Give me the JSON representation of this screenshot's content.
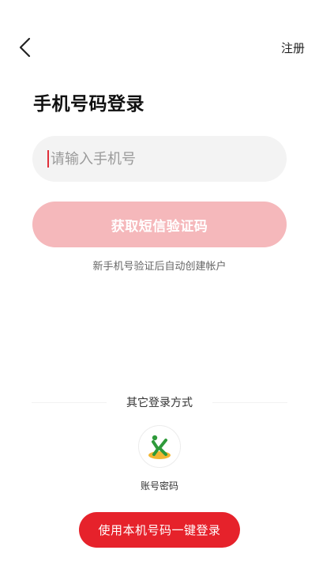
{
  "header": {
    "back_icon": "chevron-left-icon",
    "register_label": "注册"
  },
  "page": {
    "title": "手机号码登录"
  },
  "phone_input": {
    "placeholder": "请输入手机号",
    "value": ""
  },
  "sms_button": {
    "label": "获取短信验证码"
  },
  "hint": {
    "text": "新手机号验证后自动创建帐户"
  },
  "other_login": {
    "title": "其它登录方式",
    "methods": [
      {
        "label": "账号密码",
        "icon": "account-password-icon"
      }
    ]
  },
  "onekey_button": {
    "label": "使用本机号码一键登录"
  },
  "colors": {
    "accent": "#e6222b",
    "disabled_button": "#f5b8bb",
    "input_background": "#f3f3f3"
  }
}
